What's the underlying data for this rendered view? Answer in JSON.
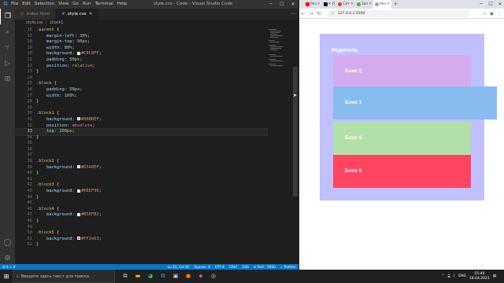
{
  "vscode": {
    "window_title": "style.css - Code - Visual Studio Code",
    "menu": [
      "File",
      "Edit",
      "Selection",
      "View",
      "Go",
      "Run",
      "Terminal",
      "Help"
    ],
    "tabs": [
      {
        "label": "index.html",
        "icon": "html-file-icon"
      },
      {
        "label": "style.css",
        "icon": "css-file-icon"
      }
    ],
    "breadcrumb": [
      "style.css",
      "›",
      ".block1"
    ],
    "status_left": [
      "⊗ 0  ⚠ 0"
    ],
    "status_right": [
      "Ln 31, Col 16",
      "Spaces: 4",
      "UTF-8",
      "CRLF",
      "CSS",
      "⊙ Port : 5500",
      "✓ Prettier"
    ],
    "code_lines": [
      {
        "n": "16",
        "tokens": [
          {
            "c": "sel",
            "t": ".parent"
          },
          {
            "c": "punc",
            "t": " {"
          }
        ]
      },
      {
        "n": "17",
        "tokens": [
          {
            "c": "prop",
            "t": "    margin-left"
          },
          {
            "c": "punc",
            "t": ": "
          },
          {
            "c": "num",
            "t": "10%"
          },
          {
            "c": "punc",
            "t": ";"
          }
        ]
      },
      {
        "n": "18",
        "tokens": [
          {
            "c": "prop",
            "t": "    margin-top"
          },
          {
            "c": "punc",
            "t": ": "
          },
          {
            "c": "num",
            "t": "50px"
          },
          {
            "c": "punc",
            "t": ";"
          }
        ]
      },
      {
        "n": "19",
        "tokens": [
          {
            "c": "prop",
            "t": "    width"
          },
          {
            "c": "punc",
            "t": ": "
          },
          {
            "c": "num",
            "t": "80%"
          },
          {
            "c": "punc",
            "t": ";"
          }
        ]
      },
      {
        "n": "20",
        "tokens": [
          {
            "c": "prop",
            "t": "    background"
          },
          {
            "c": "punc",
            "t": ": "
          },
          {
            "c": "swatch",
            "color": "#c0c0ff"
          },
          {
            "c": "val",
            "t": "#C0C0FF"
          },
          {
            "c": "punc",
            "t": ";"
          }
        ]
      },
      {
        "n": "21",
        "tokens": [
          {
            "c": "prop",
            "t": "    padding"
          },
          {
            "c": "punc",
            "t": ": "
          },
          {
            "c": "num",
            "t": "50px"
          },
          {
            "c": "punc",
            "t": ";"
          }
        ]
      },
      {
        "n": "22",
        "tokens": [
          {
            "c": "prop",
            "t": "    position"
          },
          {
            "c": "punc",
            "t": ": "
          },
          {
            "c": "kw",
            "t": "relative"
          },
          {
            "c": "punc",
            "t": ";"
          }
        ]
      },
      {
        "n": "23",
        "tokens": [
          {
            "c": "punc",
            "t": "}"
          }
        ]
      },
      {
        "n": "24",
        "tokens": []
      },
      {
        "n": "25",
        "tokens": [
          {
            "c": "sel",
            "t": ".block"
          },
          {
            "c": "punc",
            "t": " {"
          }
        ]
      },
      {
        "n": "26",
        "tokens": [
          {
            "c": "prop",
            "t": "    padding"
          },
          {
            "c": "punc",
            "t": ": "
          },
          {
            "c": "num",
            "t": "50px"
          },
          {
            "c": "punc",
            "t": ";"
          }
        ]
      },
      {
        "n": "27",
        "tokens": [
          {
            "c": "prop",
            "t": "    width"
          },
          {
            "c": "punc",
            "t": ": "
          },
          {
            "c": "num",
            "t": "100%"
          },
          {
            "c": "punc",
            "t": ";"
          }
        ]
      },
      {
        "n": "28",
        "tokens": [
          {
            "c": "punc",
            "t": "}"
          }
        ]
      },
      {
        "n": "29",
        "tokens": []
      },
      {
        "n": "30",
        "tokens": [
          {
            "c": "sel",
            "t": ".block1"
          },
          {
            "c": "punc",
            "t": " {"
          }
        ]
      },
      {
        "n": "31",
        "tokens": [
          {
            "c": "prop",
            "t": "    background"
          },
          {
            "c": "punc",
            "t": ": "
          },
          {
            "c": "swatch",
            "color": "#88bbef"
          },
          {
            "c": "val",
            "t": "#88BBEF"
          },
          {
            "c": "punc",
            "t": ";"
          }
        ]
      },
      {
        "n": "32",
        "tokens": [
          {
            "c": "prop",
            "t": "    position"
          },
          {
            "c": "punc",
            "t": ": "
          },
          {
            "c": "kw",
            "t": "absolute"
          },
          {
            "c": "punc",
            "t": ";"
          }
        ]
      },
      {
        "n": "33",
        "tokens": [
          {
            "c": "prop",
            "t": "    top"
          },
          {
            "c": "punc",
            "t": ": "
          },
          {
            "c": "num",
            "t": "200px"
          },
          {
            "c": "punc",
            "t": ";"
          }
        ],
        "current": true
      },
      {
        "n": "34",
        "tokens": [
          {
            "c": "punc",
            "t": "}"
          }
        ]
      },
      {
        "n": "35",
        "tokens": []
      },
      {
        "n": "36",
        "tokens": []
      },
      {
        "n": "37",
        "tokens": []
      },
      {
        "n": "38",
        "tokens": [
          {
            "c": "sel",
            "t": ".block2"
          },
          {
            "c": "punc",
            "t": " {"
          }
        ]
      },
      {
        "n": "39",
        "tokens": [
          {
            "c": "prop",
            "t": "    background"
          },
          {
            "c": "punc",
            "t": ": "
          },
          {
            "c": "swatch",
            "color": "#d5a0ef"
          },
          {
            "c": "val",
            "t": "#D5A0EF"
          },
          {
            "c": "punc",
            "t": ";"
          }
        ]
      },
      {
        "n": "40",
        "tokens": [
          {
            "c": "punc",
            "t": "}"
          }
        ]
      },
      {
        "n": "41",
        "tokens": []
      },
      {
        "n": "42",
        "tokens": [
          {
            "c": "sel",
            "t": ".block3"
          },
          {
            "c": "punc",
            "t": " {"
          }
        ]
      },
      {
        "n": "43",
        "tokens": [
          {
            "c": "prop",
            "t": "    background"
          },
          {
            "c": "punc",
            "t": ": "
          },
          {
            "c": "swatch",
            "color": "#e8ef96"
          },
          {
            "c": "val",
            "t": "#E8EF96"
          },
          {
            "c": "punc",
            "t": ";"
          }
        ]
      },
      {
        "n": "44",
        "tokens": [
          {
            "c": "punc",
            "t": "}"
          }
        ]
      },
      {
        "n": "45",
        "tokens": []
      },
      {
        "n": "46",
        "tokens": [
          {
            "c": "sel",
            "t": ".block4"
          },
          {
            "c": "punc",
            "t": " {"
          }
        ]
      },
      {
        "n": "47",
        "tokens": [
          {
            "c": "prop",
            "t": "    background"
          },
          {
            "c": "punc",
            "t": ": "
          },
          {
            "c": "swatch",
            "color": "#b5efb2"
          },
          {
            "c": "val",
            "t": "#B5EFB2"
          },
          {
            "c": "punc",
            "t": ";"
          }
        ]
      },
      {
        "n": "48",
        "tokens": [
          {
            "c": "punc",
            "t": "}"
          }
        ]
      },
      {
        "n": "49",
        "tokens": []
      },
      {
        "n": "50",
        "tokens": [
          {
            "c": "sel",
            "t": ".block5"
          },
          {
            "c": "punc",
            "t": " {"
          }
        ]
      },
      {
        "n": "51",
        "tokens": [
          {
            "c": "prop",
            "t": "    background"
          },
          {
            "c": "punc",
            "t": ": "
          },
          {
            "c": "swatch",
            "color": "#ff2e63"
          },
          {
            "c": "val",
            "t": "#FF2e63"
          },
          {
            "c": "punc",
            "t": ";"
          }
        ]
      },
      {
        "n": "52",
        "tokens": [
          {
            "c": "punc",
            "t": "}"
          }
        ]
      }
    ]
  },
  "chrome": {
    "tabs": [
      {
        "label": "Рез",
        "favicon_color": "#ff0000"
      },
      {
        "label": "✕ О",
        "favicon_color": "#111111"
      },
      {
        "label": "Сет",
        "favicon_color": "#e53935"
      },
      {
        "label": "Зап",
        "favicon_color": "#4caf50"
      },
      {
        "label": "Рез",
        "favicon_color": "#5f6368",
        "active": true
      }
    ],
    "url": "127.0.0.1:5500"
  },
  "page": {
    "parent_title": "Родитель",
    "blocks": [
      {
        "label": "Блок 2",
        "color": "#d4acee"
      },
      {
        "label": "Блок 1",
        "color": "#88bbef"
      },
      {
        "label": "Блок 4",
        "color": "#b2e0a9"
      },
      {
        "label": "Блок 5",
        "color": "#ff4562"
      }
    ]
  },
  "taskbar": {
    "search_placeholder": "Введите здесь текст для поиска",
    "language": "ENG",
    "time": "15:40",
    "date": "18.04.2021"
  }
}
